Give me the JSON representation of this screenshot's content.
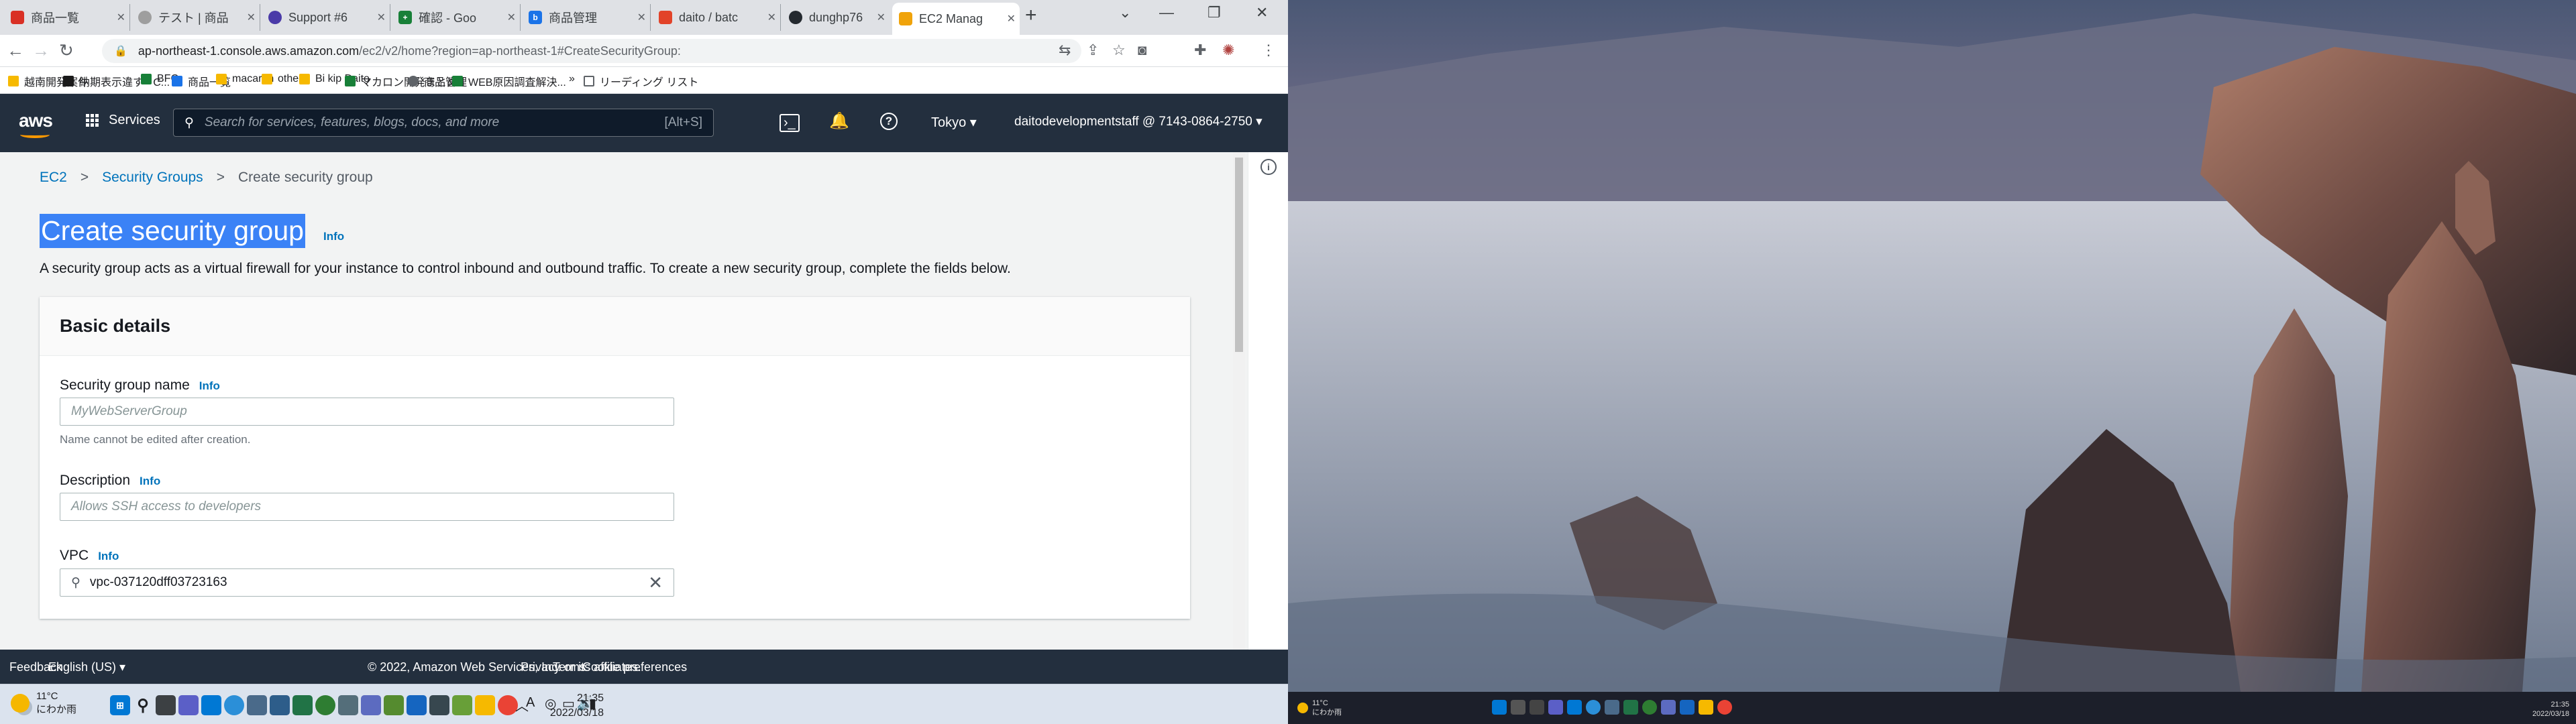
{
  "browser": {
    "tabs": [
      {
        "title": "商品一覧",
        "icon_color": "#d93025"
      },
      {
        "title": "テスト | 商品",
        "icon_color": "#9e9e9e"
      },
      {
        "title": "Support #6",
        "icon_color": "#4a3aa8"
      },
      {
        "title": "確認 - Goo",
        "icon_color": "#188038"
      },
      {
        "title": "商品管理",
        "icon_color": "#1a73e8"
      },
      {
        "title": "daito / batc",
        "icon_color": "#e24329"
      },
      {
        "title": "dunghp76",
        "icon_color": "#24292f"
      },
      {
        "title": "EC2 Manag",
        "icon_color": "#f0a30a"
      }
    ],
    "url_host": "ap-northeast-1.console.aws.amazon.com",
    "url_path": "/ec2/v2/home?region=ap-northeast-1#CreateSecurityGroup:",
    "bookmarks": [
      {
        "label": "越南開発案件",
        "color": "#f6b900"
      },
      {
        "label": "納期表示違す - C...",
        "color": "#1a1a1a"
      },
      {
        "label": "BFC",
        "color": "#188038"
      },
      {
        "label": "商品一覧",
        "color": "#1a73e8"
      },
      {
        "label": "macaron",
        "color": "#f6b900"
      },
      {
        "label": "other",
        "color": "#f6b900"
      },
      {
        "label": "Bi kip Daito",
        "color": "#f6b900"
      },
      {
        "label": "マカロン開発まとめ",
        "color": "#188038"
      },
      {
        "label": "商品管理",
        "color": "#5f6368"
      },
      {
        "label": "WEB原因調査解決...",
        "color": "#188038"
      }
    ],
    "bookmarks_more": "»",
    "reading_list": "リーディング リスト"
  },
  "aws_header": {
    "logo": "aws",
    "services": "Services",
    "search_placeholder": "Search for services, features, blogs, docs, and more",
    "search_shortcut": "[Alt+S]",
    "region": "Tokyo ▾",
    "account": "daitodevelopmentstaff @ 7143-0864-2750 ▾"
  },
  "breadcrumb": {
    "item1": "EC2",
    "item2": "Security Groups",
    "item3": "Create security group",
    "sep": ">"
  },
  "page": {
    "title": "Create security group",
    "title_info": "Info",
    "description": "A security group acts as a virtual firewall for your instance to control inbound and outbound traffic. To create a new security group, complete the fields below."
  },
  "basic_details": {
    "heading": "Basic details",
    "name_label": "Security group name",
    "name_info": "Info",
    "name_placeholder": "MyWebServerGroup",
    "name_hint": "Name cannot be edited after creation.",
    "desc_label": "Description",
    "desc_info": "Info",
    "desc_placeholder": "Allows SSH access to developers",
    "vpc_label": "VPC",
    "vpc_info": "Info",
    "vpc_value": "vpc-037120dff03723163"
  },
  "footer": {
    "feedback": "Feedback",
    "language": "English (US) ▾",
    "copyright": "© 2022, Amazon Web Services, Inc. or its affiliates.",
    "privacy": "Privacy",
    "terms": "Terms",
    "cookies": "Cookie preferences"
  },
  "taskbar": {
    "temp": "11°C",
    "weather": "にわか雨",
    "time": "21:35",
    "date": "2022/03/18",
    "ime": "A"
  }
}
